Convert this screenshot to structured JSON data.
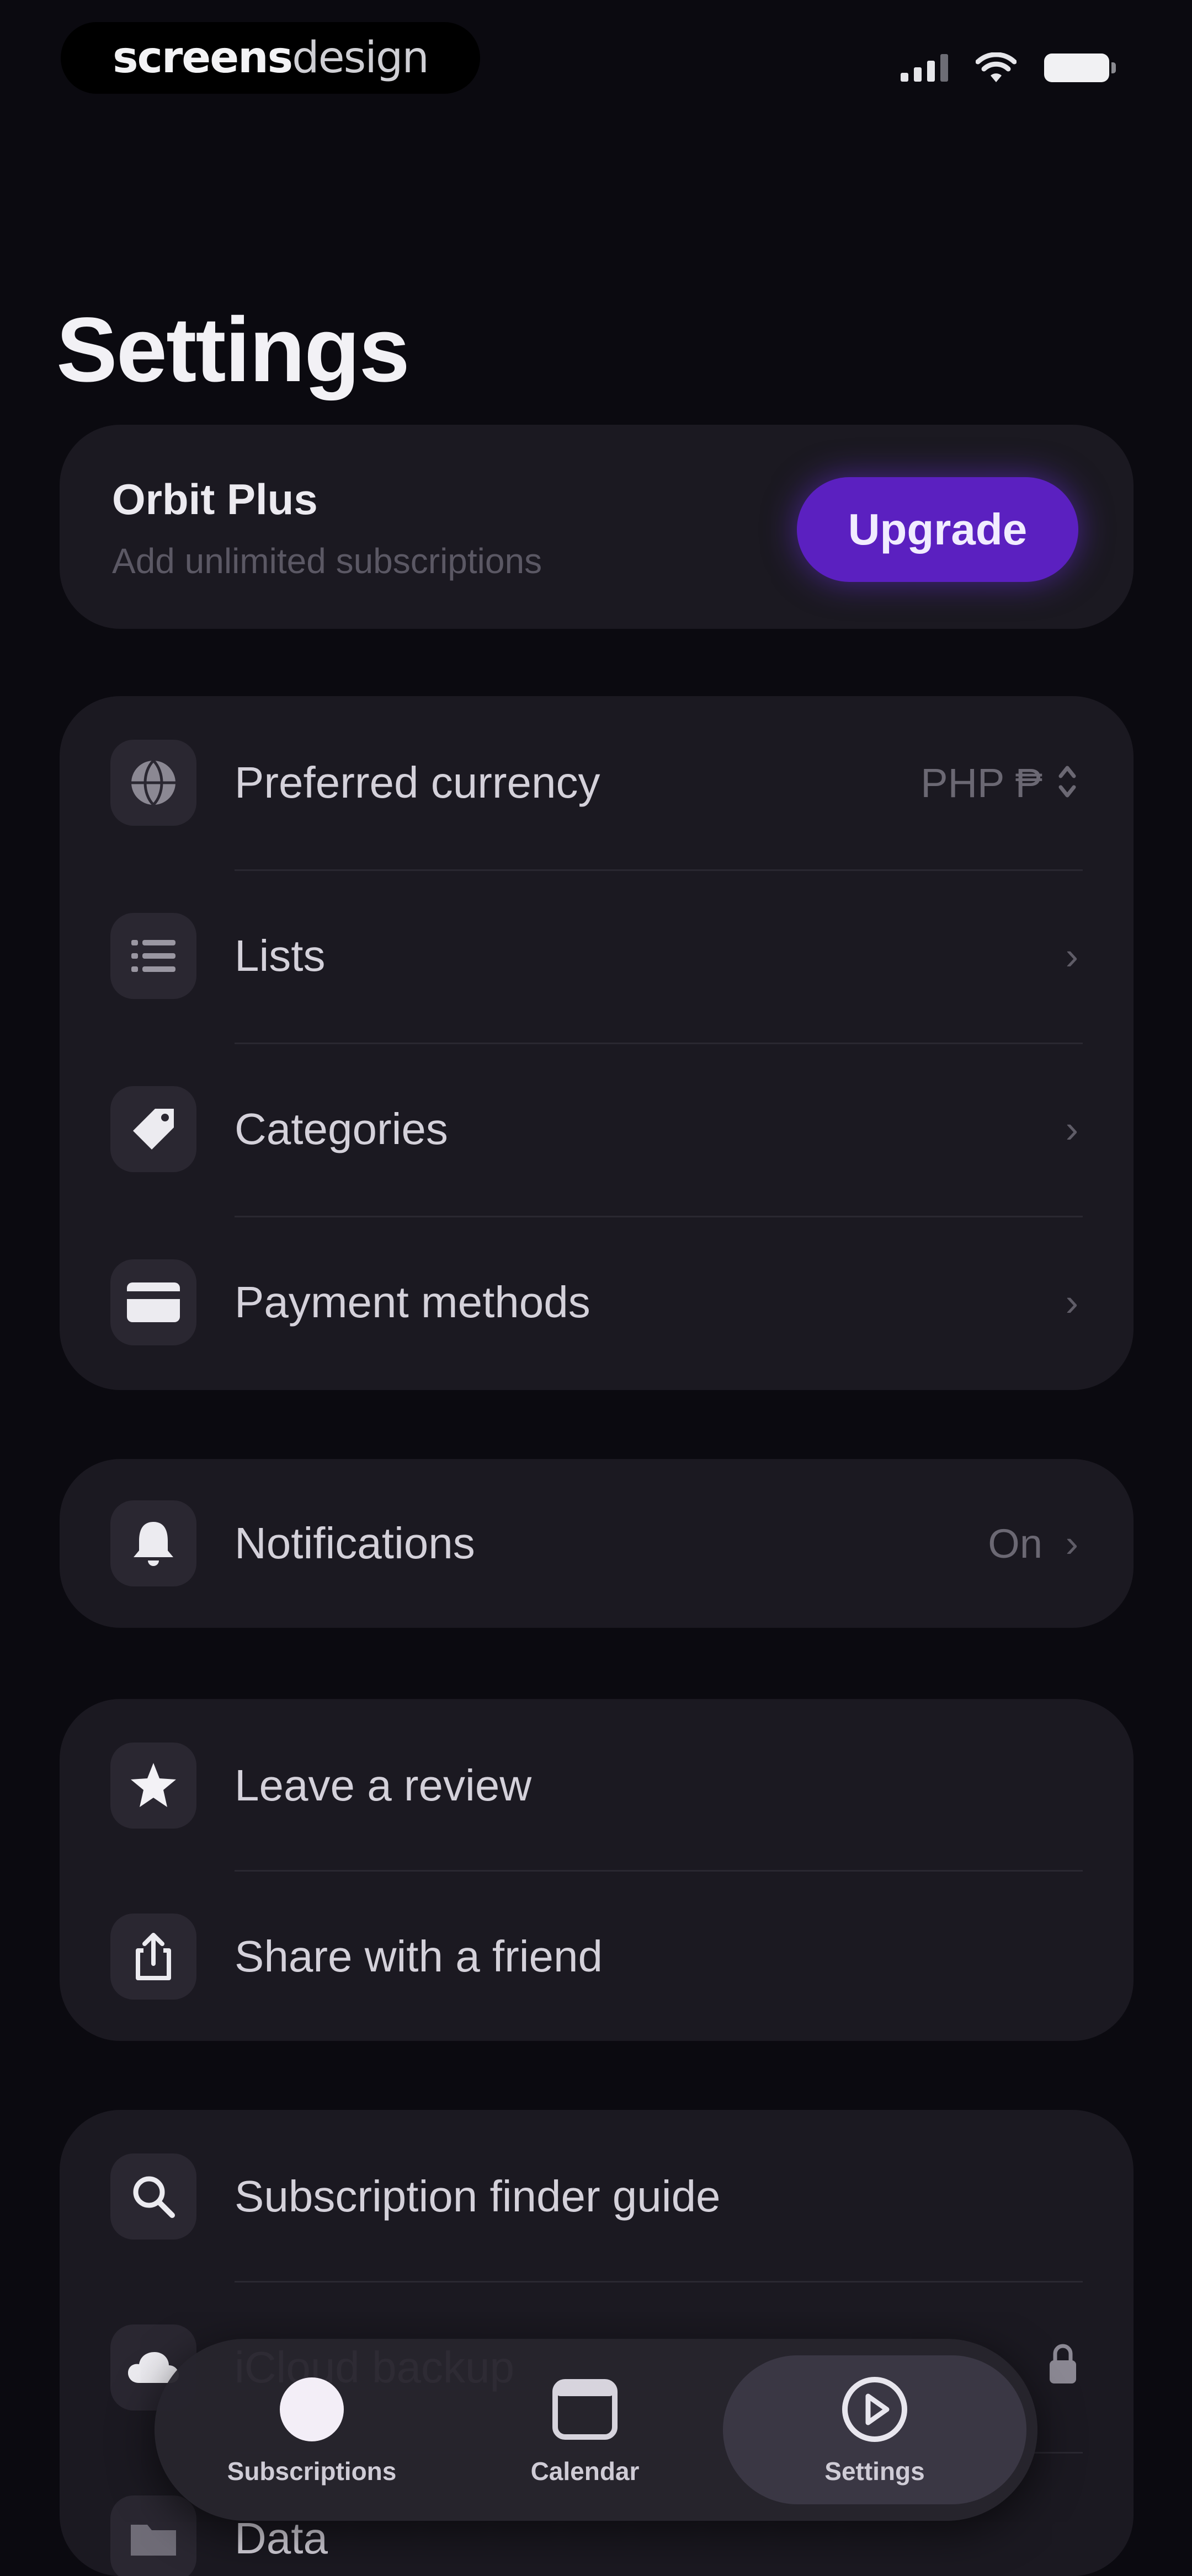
{
  "status_bar": {
    "brand_bold": "screens",
    "brand_light": "design"
  },
  "title": "Settings",
  "plus": {
    "title": "Orbit Plus",
    "subtitle": "Add unlimited subscriptions",
    "button_label": "Upgrade",
    "accent_color": "#5b20c0"
  },
  "groups": [
    {
      "rows": [
        {
          "label": "Preferred currency",
          "value": "PHP ₱",
          "icon": "globe-icon",
          "control": "updown"
        },
        {
          "label": "Lists",
          "icon": "list-icon",
          "control": "chevron"
        },
        {
          "label": "Categories",
          "icon": "tag-icon",
          "control": "chevron"
        },
        {
          "label": "Payment methods",
          "icon": "credit-card-icon",
          "control": "chevron"
        }
      ]
    },
    {
      "rows": [
        {
          "label": "Notifications",
          "value": "On",
          "icon": "bell-icon",
          "control": "chevron"
        }
      ]
    },
    {
      "rows": [
        {
          "label": "Leave a review",
          "icon": "star-icon",
          "control": "none"
        },
        {
          "label": "Share with a friend",
          "icon": "share-icon",
          "control": "none"
        }
      ]
    },
    {
      "rows": [
        {
          "label": "Subscription finder guide",
          "icon": "search-icon",
          "control": "none"
        },
        {
          "label": "iCloud backup",
          "icon": "cloud-icon",
          "control": "lock"
        },
        {
          "label": "Data",
          "icon": "folder-icon",
          "control": "none"
        }
      ]
    }
  ],
  "tab_bar": {
    "tabs": [
      {
        "label": "Subscriptions",
        "icon": "subscriptions-icon"
      },
      {
        "label": "Calendar",
        "icon": "calendar-icon"
      },
      {
        "label": "Settings",
        "icon": "settings-icon",
        "selected": true
      }
    ]
  }
}
